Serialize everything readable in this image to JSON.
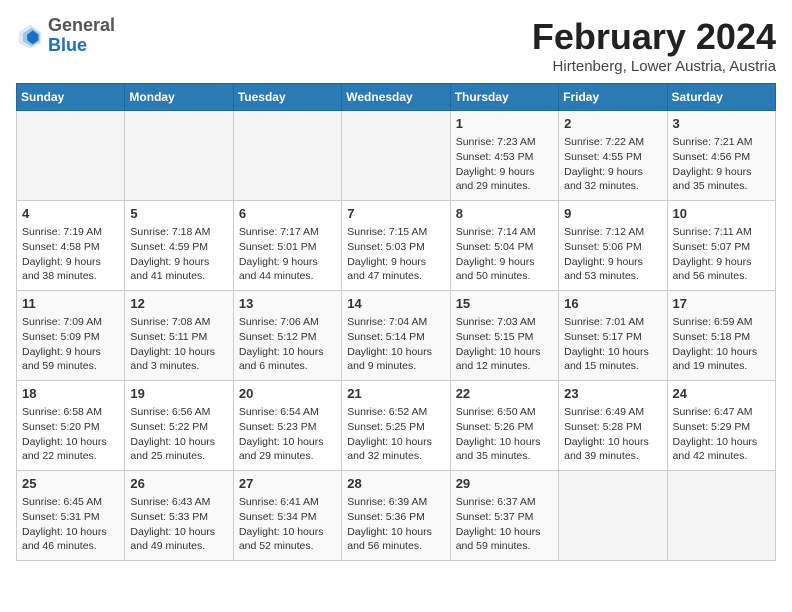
{
  "header": {
    "logo_general": "General",
    "logo_blue": "Blue",
    "month_title": "February 2024",
    "location": "Hirtenberg, Lower Austria, Austria"
  },
  "weekdays": [
    "Sunday",
    "Monday",
    "Tuesday",
    "Wednesday",
    "Thursday",
    "Friday",
    "Saturday"
  ],
  "weeks": [
    [
      {
        "day": "",
        "content": ""
      },
      {
        "day": "",
        "content": ""
      },
      {
        "day": "",
        "content": ""
      },
      {
        "day": "",
        "content": ""
      },
      {
        "day": "1",
        "content": "Sunrise: 7:23 AM\nSunset: 4:53 PM\nDaylight: 9 hours and 29 minutes."
      },
      {
        "day": "2",
        "content": "Sunrise: 7:22 AM\nSunset: 4:55 PM\nDaylight: 9 hours and 32 minutes."
      },
      {
        "day": "3",
        "content": "Sunrise: 7:21 AM\nSunset: 4:56 PM\nDaylight: 9 hours and 35 minutes."
      }
    ],
    [
      {
        "day": "4",
        "content": "Sunrise: 7:19 AM\nSunset: 4:58 PM\nDaylight: 9 hours and 38 minutes."
      },
      {
        "day": "5",
        "content": "Sunrise: 7:18 AM\nSunset: 4:59 PM\nDaylight: 9 hours and 41 minutes."
      },
      {
        "day": "6",
        "content": "Sunrise: 7:17 AM\nSunset: 5:01 PM\nDaylight: 9 hours and 44 minutes."
      },
      {
        "day": "7",
        "content": "Sunrise: 7:15 AM\nSunset: 5:03 PM\nDaylight: 9 hours and 47 minutes."
      },
      {
        "day": "8",
        "content": "Sunrise: 7:14 AM\nSunset: 5:04 PM\nDaylight: 9 hours and 50 minutes."
      },
      {
        "day": "9",
        "content": "Sunrise: 7:12 AM\nSunset: 5:06 PM\nDaylight: 9 hours and 53 minutes."
      },
      {
        "day": "10",
        "content": "Sunrise: 7:11 AM\nSunset: 5:07 PM\nDaylight: 9 hours and 56 minutes."
      }
    ],
    [
      {
        "day": "11",
        "content": "Sunrise: 7:09 AM\nSunset: 5:09 PM\nDaylight: 9 hours and 59 minutes."
      },
      {
        "day": "12",
        "content": "Sunrise: 7:08 AM\nSunset: 5:11 PM\nDaylight: 10 hours and 3 minutes."
      },
      {
        "day": "13",
        "content": "Sunrise: 7:06 AM\nSunset: 5:12 PM\nDaylight: 10 hours and 6 minutes."
      },
      {
        "day": "14",
        "content": "Sunrise: 7:04 AM\nSunset: 5:14 PM\nDaylight: 10 hours and 9 minutes."
      },
      {
        "day": "15",
        "content": "Sunrise: 7:03 AM\nSunset: 5:15 PM\nDaylight: 10 hours and 12 minutes."
      },
      {
        "day": "16",
        "content": "Sunrise: 7:01 AM\nSunset: 5:17 PM\nDaylight: 10 hours and 15 minutes."
      },
      {
        "day": "17",
        "content": "Sunrise: 6:59 AM\nSunset: 5:18 PM\nDaylight: 10 hours and 19 minutes."
      }
    ],
    [
      {
        "day": "18",
        "content": "Sunrise: 6:58 AM\nSunset: 5:20 PM\nDaylight: 10 hours and 22 minutes."
      },
      {
        "day": "19",
        "content": "Sunrise: 6:56 AM\nSunset: 5:22 PM\nDaylight: 10 hours and 25 minutes."
      },
      {
        "day": "20",
        "content": "Sunrise: 6:54 AM\nSunset: 5:23 PM\nDaylight: 10 hours and 29 minutes."
      },
      {
        "day": "21",
        "content": "Sunrise: 6:52 AM\nSunset: 5:25 PM\nDaylight: 10 hours and 32 minutes."
      },
      {
        "day": "22",
        "content": "Sunrise: 6:50 AM\nSunset: 5:26 PM\nDaylight: 10 hours and 35 minutes."
      },
      {
        "day": "23",
        "content": "Sunrise: 6:49 AM\nSunset: 5:28 PM\nDaylight: 10 hours and 39 minutes."
      },
      {
        "day": "24",
        "content": "Sunrise: 6:47 AM\nSunset: 5:29 PM\nDaylight: 10 hours and 42 minutes."
      }
    ],
    [
      {
        "day": "25",
        "content": "Sunrise: 6:45 AM\nSunset: 5:31 PM\nDaylight: 10 hours and 46 minutes."
      },
      {
        "day": "26",
        "content": "Sunrise: 6:43 AM\nSunset: 5:33 PM\nDaylight: 10 hours and 49 minutes."
      },
      {
        "day": "27",
        "content": "Sunrise: 6:41 AM\nSunset: 5:34 PM\nDaylight: 10 hours and 52 minutes."
      },
      {
        "day": "28",
        "content": "Sunrise: 6:39 AM\nSunset: 5:36 PM\nDaylight: 10 hours and 56 minutes."
      },
      {
        "day": "29",
        "content": "Sunrise: 6:37 AM\nSunset: 5:37 PM\nDaylight: 10 hours and 59 minutes."
      },
      {
        "day": "",
        "content": ""
      },
      {
        "day": "",
        "content": ""
      }
    ]
  ]
}
